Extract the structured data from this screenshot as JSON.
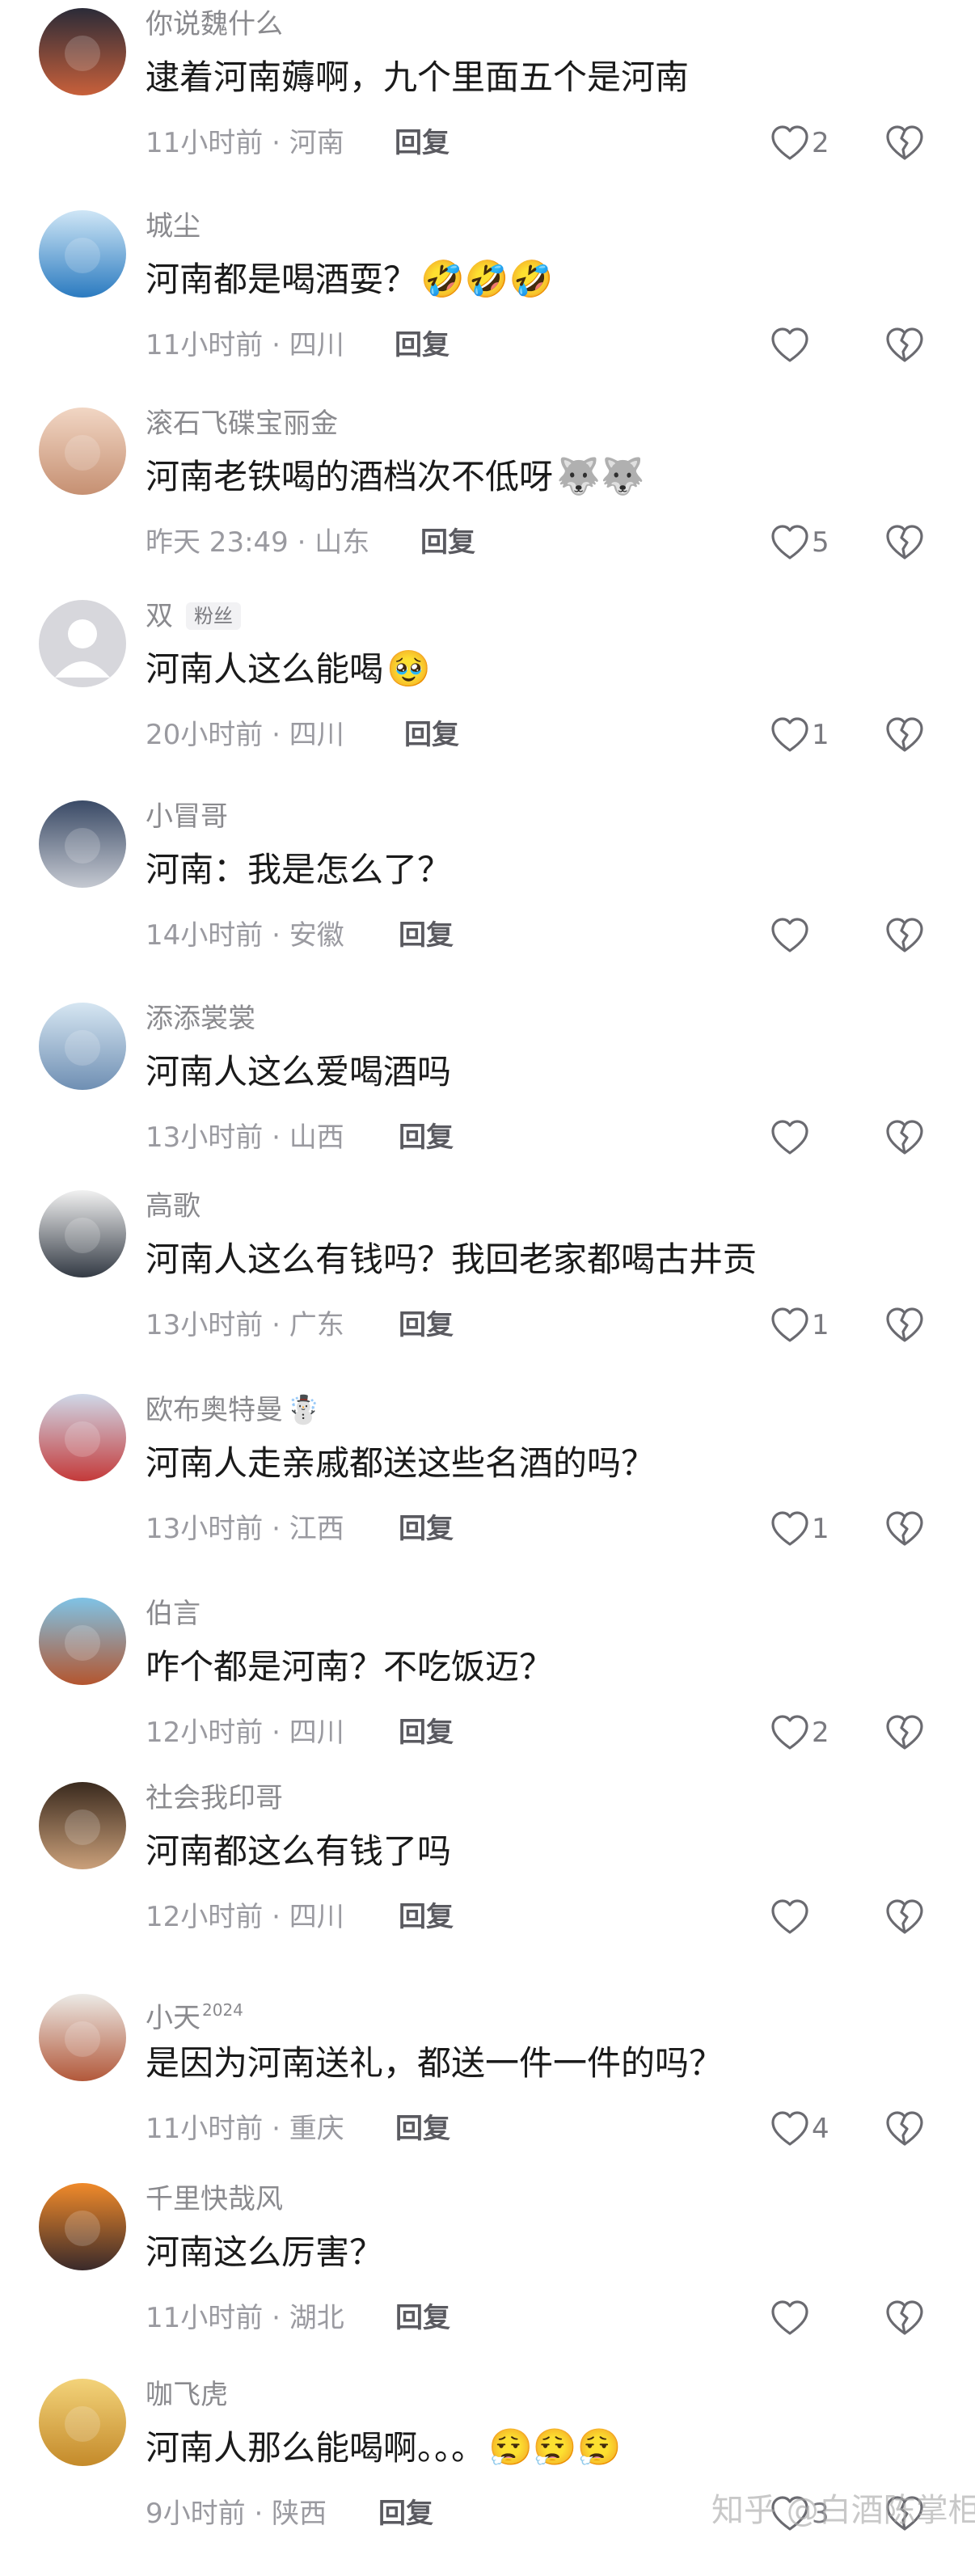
{
  "comments": [
    {
      "username": "你说魏什么",
      "text": "逮着河南薅啊，九个里面五个是河南",
      "emoji": "",
      "time": "11小时前",
      "location": "河南",
      "reply": "回复",
      "likes": "2"
    },
    {
      "username": "城尘",
      "text": "河南都是喝酒耍？",
      "emoji": "🤣🤣🤣",
      "time": "11小时前",
      "location": "四川",
      "reply": "回复",
      "likes": ""
    },
    {
      "username": "滚石飞碟宝丽金",
      "text": "河南老铁喝的酒档次不低呀",
      "emoji": "🐺🐺",
      "time": "昨天 23:49",
      "location": "山东",
      "reply": "回复",
      "likes": "5"
    },
    {
      "username": "双",
      "badge": "粉丝",
      "text": "河南人这么能喝",
      "emoji": "🥹",
      "time": "20小时前",
      "location": "四川",
      "reply": "回复",
      "likes": "1"
    },
    {
      "username": "小冒哥",
      "text": "河南：我是怎么了？",
      "emoji": "",
      "time": "14小时前",
      "location": "安徽",
      "reply": "回复",
      "likes": ""
    },
    {
      "username": "添添裳裳",
      "text": "河南人这么爱喝酒吗",
      "emoji": "",
      "time": "13小时前",
      "location": "山西",
      "reply": "回复",
      "likes": ""
    },
    {
      "username": "高歌",
      "text": "河南人这么有钱吗？我回老家都喝古井贡",
      "emoji": "",
      "time": "13小时前",
      "location": "广东",
      "reply": "回复",
      "likes": "1"
    },
    {
      "username": "欧布奥特曼",
      "username_emoji": "☃️",
      "text": "河南人走亲戚都送这些名酒的吗？",
      "emoji": "",
      "time": "13小时前",
      "location": "江西",
      "reply": "回复",
      "likes": "1"
    },
    {
      "username": "伯言",
      "text": "咋个都是河南？不吃饭迈？",
      "emoji": "",
      "time": "12小时前",
      "location": "四川",
      "reply": "回复",
      "likes": "2"
    },
    {
      "username": "社会我印哥",
      "text": "河南都这么有钱了吗",
      "emoji": "",
      "time": "12小时前",
      "location": "四川",
      "reply": "回复",
      "likes": ""
    },
    {
      "username": "小天",
      "username_sup": "2024",
      "text": "是因为河南送礼，都送一件一件的吗？",
      "emoji": "",
      "time": "11小时前",
      "location": "重庆",
      "reply": "回复",
      "likes": "4"
    },
    {
      "username": "千里快哉风",
      "text": "河南这么厉害？",
      "emoji": "",
      "time": "11小时前",
      "location": "湖北",
      "reply": "回复",
      "likes": ""
    },
    {
      "username": "咖飞虎",
      "text": "河南人那么能喝啊。。。",
      "emoji": "😮‍💨😮‍💨😮‍💨",
      "time": "9小时前",
      "location": "陕西",
      "reply": "回复",
      "likes": "3"
    }
  ],
  "watermark": "知乎 @白酒陈掌柜",
  "colors": {
    "meta": "#9a9aa0",
    "username": "#8a8a8e",
    "text": "#1a1a1a"
  }
}
